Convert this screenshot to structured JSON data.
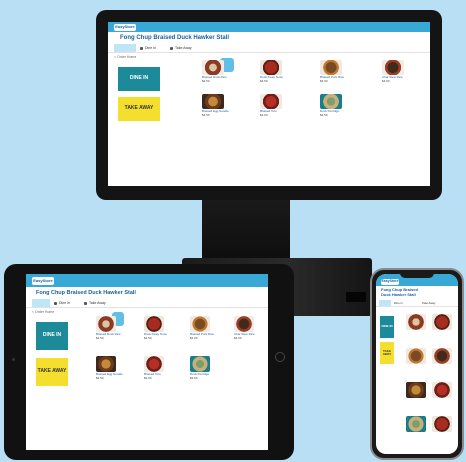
{
  "app": {
    "logo": "EasyStore",
    "store_title": "Fong Chup Braised Duck Hawker Stall",
    "store_title_short": "Fong Chup Braised Duck Hawker Stall"
  },
  "tabs": [
    "Dine In",
    "Take Away"
  ],
  "breadcrumb": "< Order Home",
  "order_types": {
    "dine_in": "DINE IN",
    "take_away": "TAKE AWAY"
  },
  "menu_items": [
    {
      "name": "Braised Duck Rice",
      "price": "$4.50",
      "dish": "dish-a"
    },
    {
      "name": "Duck Kway Teow",
      "price": "$4.50",
      "dish": "dish-b"
    },
    {
      "name": "Braised Pork Rice",
      "price": "$4.00",
      "dish": "dish-c"
    },
    {
      "name": "Char Siew Rice",
      "price": "$4.00",
      "dish": "dish-d"
    },
    {
      "name": "Braised Egg Noodle",
      "price": "$3.50",
      "dish": "dish-e"
    },
    {
      "name": "Braised Tofu",
      "price": "$2.00",
      "dish": "dish-f"
    },
    {
      "name": "Duck Porridge",
      "price": "$3.50",
      "dish": "dish-g"
    }
  ]
}
